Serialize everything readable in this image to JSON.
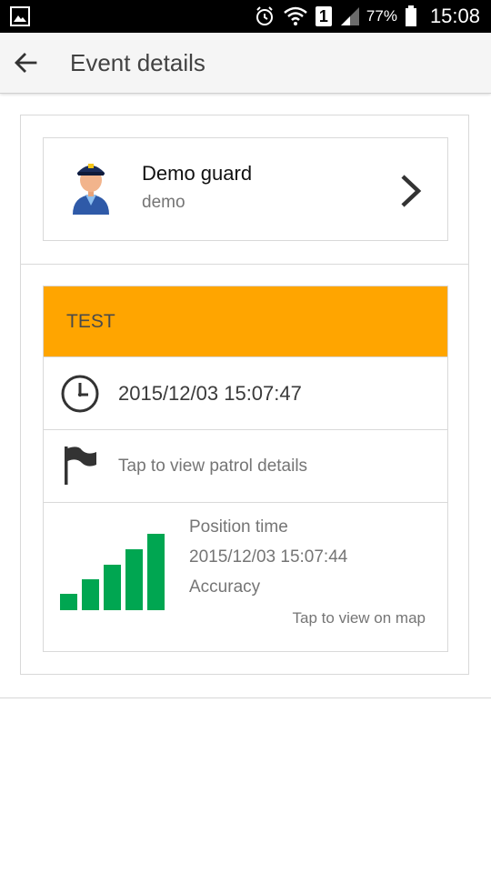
{
  "status_bar": {
    "battery_percent": "77%",
    "clock": "15:08",
    "sim_slot": "1",
    "icons": [
      "image-notification-icon",
      "alarm-icon",
      "wifi-icon",
      "sim-icon",
      "cell-signal-icon",
      "battery-icon"
    ]
  },
  "app_bar": {
    "title": "Event details",
    "back_icon": "arrow-back-icon"
  },
  "guard": {
    "name": "Demo guard",
    "username": "demo",
    "avatar_icon": "guard-avatar-icon",
    "chevron_icon": "chevron-right-icon"
  },
  "event": {
    "type_label": "TEST",
    "header_color": "#FFA500",
    "timestamp": "2015/12/03 15:07:47",
    "patrol_link": "Tap to view patrol details",
    "position": {
      "label": "Position time",
      "time": "2015/12/03 15:07:44",
      "accuracy_label": "Accuracy",
      "accuracy_level": "5/5",
      "accuracy_color": "#00A651",
      "map_link": "Tap to view on map"
    }
  }
}
